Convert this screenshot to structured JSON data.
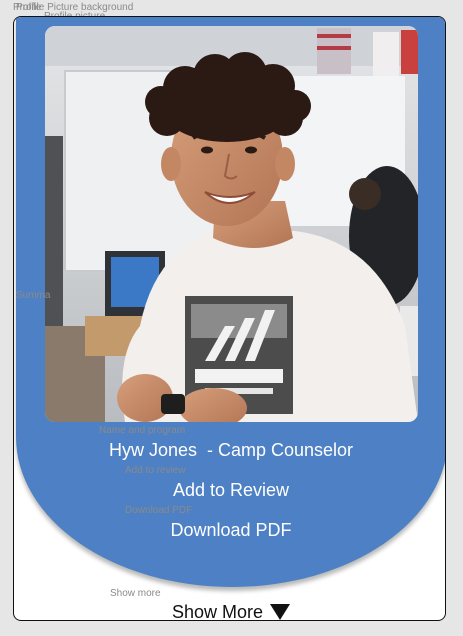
{
  "layers": {
    "profile": "Profile",
    "profile_picture_background": "Profile Picture background",
    "profile_picture": "Profile picture",
    "summary": "Summa",
    "name_and_program": "Name and program",
    "add_to_review": "Add to review",
    "download_pdf": "Download PDF",
    "show_more": "Show more"
  },
  "profile": {
    "name_program": "Hyw Jones  - Camp Counselor",
    "add_to_review_label": "Add to Review",
    "download_pdf_label": "Download PDF",
    "show_more_label": "Show More",
    "show_more_icon": "triangle-down-icon"
  },
  "colors": {
    "card_blue": "#4d80c4",
    "text_on_blue": "#ffffff",
    "card_border": "#111111",
    "canvas": "#e6e6e6"
  }
}
